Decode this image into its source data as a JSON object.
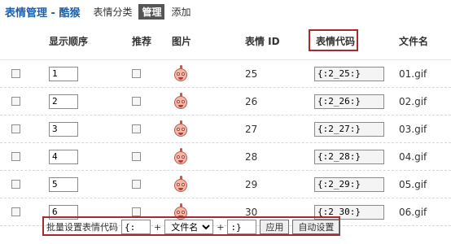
{
  "header": {
    "title": "表情管理 - 酷猴",
    "subnav": [
      "表情分类",
      "管理",
      "添加"
    ]
  },
  "table": {
    "columns": [
      "显示顺序",
      "推荐",
      "图片",
      "表情 ID",
      "表情代码",
      "文件名"
    ],
    "rows": [
      {
        "order": "1",
        "id": "25",
        "code": "{:2_25:}",
        "file": "01.gif"
      },
      {
        "order": "2",
        "id": "26",
        "code": "{:2_26:}",
        "file": "02.gif"
      },
      {
        "order": "3",
        "id": "27",
        "code": "{:2_27:}",
        "file": "03.gif"
      },
      {
        "order": "4",
        "id": "28",
        "code": "{:2_28:}",
        "file": "04.gif"
      },
      {
        "order": "5",
        "id": "29",
        "code": "{:2_29:}",
        "file": "05.gif"
      },
      {
        "order": "6",
        "id": "30",
        "code": "{:2_30:}",
        "file": "06.gif"
      }
    ]
  },
  "batch": {
    "label": "批量设置表情代码",
    "prefix": "{:",
    "plus1": "+",
    "select_value": "文件名",
    "plus2": "+",
    "suffix": ":}",
    "apply": "应用",
    "auto": "自动设置"
  }
}
